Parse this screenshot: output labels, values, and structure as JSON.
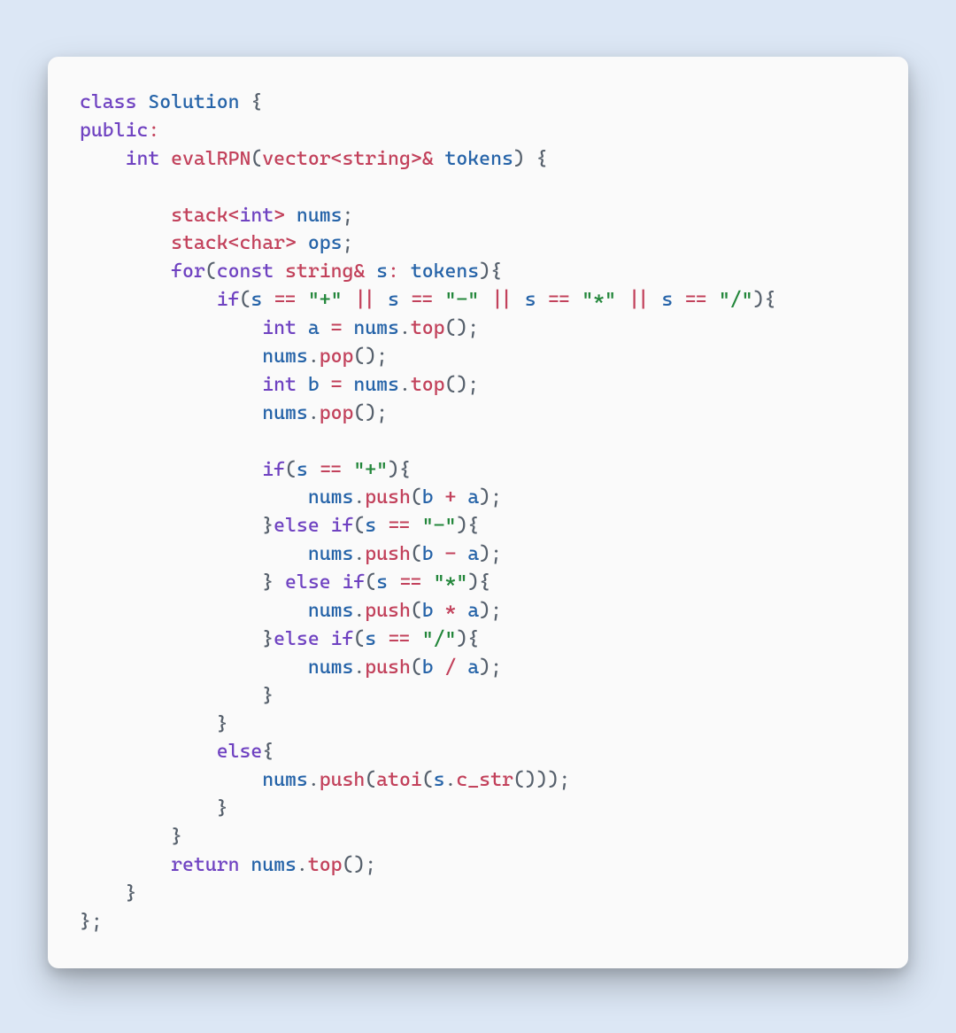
{
  "tokens": [
    [
      [
        "kw",
        "class"
      ],
      [
        "punc",
        " "
      ],
      [
        "name",
        "Solution"
      ],
      [
        "punc",
        " {"
      ]
    ],
    [
      [
        "kw",
        "public"
      ],
      [
        "op",
        ":"
      ]
    ],
    [
      [
        "punc",
        "    "
      ],
      [
        "kw",
        "int"
      ],
      [
        "punc",
        " "
      ],
      [
        "fn",
        "evalRPN"
      ],
      [
        "punc",
        "("
      ],
      [
        "type",
        "vector"
      ],
      [
        "op",
        "<"
      ],
      [
        "type",
        "string"
      ],
      [
        "op",
        ">&"
      ],
      [
        "punc",
        " "
      ],
      [
        "name",
        "tokens"
      ],
      [
        "punc",
        ") {"
      ]
    ],
    [
      [
        "punc",
        ""
      ]
    ],
    [
      [
        "punc",
        "        "
      ],
      [
        "type",
        "stack"
      ],
      [
        "op",
        "<"
      ],
      [
        "kw",
        "int"
      ],
      [
        "op",
        ">"
      ],
      [
        "punc",
        " "
      ],
      [
        "name",
        "nums"
      ],
      [
        "punc",
        ";"
      ]
    ],
    [
      [
        "punc",
        "        "
      ],
      [
        "type",
        "stack"
      ],
      [
        "op",
        "<"
      ],
      [
        "type",
        "char"
      ],
      [
        "op",
        ">"
      ],
      [
        "punc",
        " "
      ],
      [
        "name",
        "ops"
      ],
      [
        "punc",
        ";"
      ]
    ],
    [
      [
        "punc",
        "        "
      ],
      [
        "kw",
        "for"
      ],
      [
        "punc",
        "("
      ],
      [
        "kw",
        "const"
      ],
      [
        "punc",
        " "
      ],
      [
        "type",
        "string"
      ],
      [
        "op",
        "&"
      ],
      [
        "punc",
        " "
      ],
      [
        "name",
        "s"
      ],
      [
        "op",
        ":"
      ],
      [
        "punc",
        " "
      ],
      [
        "name",
        "tokens"
      ],
      [
        "punc",
        "){"
      ]
    ],
    [
      [
        "punc",
        "            "
      ],
      [
        "kw",
        "if"
      ],
      [
        "punc",
        "("
      ],
      [
        "name",
        "s"
      ],
      [
        "punc",
        " "
      ],
      [
        "op",
        "=="
      ],
      [
        "punc",
        " "
      ],
      [
        "str",
        "\"+\""
      ],
      [
        "punc",
        " "
      ],
      [
        "op",
        "||"
      ],
      [
        "punc",
        " "
      ],
      [
        "name",
        "s"
      ],
      [
        "punc",
        " "
      ],
      [
        "op",
        "=="
      ],
      [
        "punc",
        " "
      ],
      [
        "str",
        "\"-\""
      ],
      [
        "punc",
        " "
      ],
      [
        "op",
        "||"
      ],
      [
        "punc",
        " "
      ],
      [
        "name",
        "s"
      ],
      [
        "punc",
        " "
      ],
      [
        "op",
        "=="
      ],
      [
        "punc",
        " "
      ],
      [
        "str",
        "\"*\""
      ],
      [
        "punc",
        " "
      ],
      [
        "op",
        "||"
      ],
      [
        "punc",
        " "
      ],
      [
        "name",
        "s"
      ],
      [
        "punc",
        " "
      ],
      [
        "op",
        "=="
      ],
      [
        "punc",
        " "
      ],
      [
        "str",
        "\"/\""
      ],
      [
        "punc",
        "){"
      ]
    ],
    [
      [
        "punc",
        "                "
      ],
      [
        "kw",
        "int"
      ],
      [
        "punc",
        " "
      ],
      [
        "name",
        "a"
      ],
      [
        "punc",
        " "
      ],
      [
        "op",
        "="
      ],
      [
        "punc",
        " "
      ],
      [
        "name",
        "nums"
      ],
      [
        "punc",
        "."
      ],
      [
        "fn",
        "top"
      ],
      [
        "punc",
        "();"
      ]
    ],
    [
      [
        "punc",
        "                "
      ],
      [
        "name",
        "nums"
      ],
      [
        "punc",
        "."
      ],
      [
        "fn",
        "pop"
      ],
      [
        "punc",
        "();"
      ]
    ],
    [
      [
        "punc",
        "                "
      ],
      [
        "kw",
        "int"
      ],
      [
        "punc",
        " "
      ],
      [
        "name",
        "b"
      ],
      [
        "punc",
        " "
      ],
      [
        "op",
        "="
      ],
      [
        "punc",
        " "
      ],
      [
        "name",
        "nums"
      ],
      [
        "punc",
        "."
      ],
      [
        "fn",
        "top"
      ],
      [
        "punc",
        "();"
      ]
    ],
    [
      [
        "punc",
        "                "
      ],
      [
        "name",
        "nums"
      ],
      [
        "punc",
        "."
      ],
      [
        "fn",
        "pop"
      ],
      [
        "punc",
        "();"
      ]
    ],
    [
      [
        "punc",
        ""
      ]
    ],
    [
      [
        "punc",
        "                "
      ],
      [
        "kw",
        "if"
      ],
      [
        "punc",
        "("
      ],
      [
        "name",
        "s"
      ],
      [
        "punc",
        " "
      ],
      [
        "op",
        "=="
      ],
      [
        "punc",
        " "
      ],
      [
        "str",
        "\"+\""
      ],
      [
        "punc",
        "){"
      ]
    ],
    [
      [
        "punc",
        "                    "
      ],
      [
        "name",
        "nums"
      ],
      [
        "punc",
        "."
      ],
      [
        "fn",
        "push"
      ],
      [
        "punc",
        "("
      ],
      [
        "name",
        "b"
      ],
      [
        "punc",
        " "
      ],
      [
        "op",
        "+"
      ],
      [
        "punc",
        " "
      ],
      [
        "name",
        "a"
      ],
      [
        "punc",
        ");"
      ]
    ],
    [
      [
        "punc",
        "                }"
      ],
      [
        "kw",
        "else"
      ],
      [
        "punc",
        " "
      ],
      [
        "kw",
        "if"
      ],
      [
        "punc",
        "("
      ],
      [
        "name",
        "s"
      ],
      [
        "punc",
        " "
      ],
      [
        "op",
        "=="
      ],
      [
        "punc",
        " "
      ],
      [
        "str",
        "\"-\""
      ],
      [
        "punc",
        "){"
      ]
    ],
    [
      [
        "punc",
        "                    "
      ],
      [
        "name",
        "nums"
      ],
      [
        "punc",
        "."
      ],
      [
        "fn",
        "push"
      ],
      [
        "punc",
        "("
      ],
      [
        "name",
        "b"
      ],
      [
        "punc",
        " "
      ],
      [
        "op",
        "-"
      ],
      [
        "punc",
        " "
      ],
      [
        "name",
        "a"
      ],
      [
        "punc",
        ");"
      ]
    ],
    [
      [
        "punc",
        "                } "
      ],
      [
        "kw",
        "else"
      ],
      [
        "punc",
        " "
      ],
      [
        "kw",
        "if"
      ],
      [
        "punc",
        "("
      ],
      [
        "name",
        "s"
      ],
      [
        "punc",
        " "
      ],
      [
        "op",
        "=="
      ],
      [
        "punc",
        " "
      ],
      [
        "str",
        "\"*\""
      ],
      [
        "punc",
        "){"
      ]
    ],
    [
      [
        "punc",
        "                    "
      ],
      [
        "name",
        "nums"
      ],
      [
        "punc",
        "."
      ],
      [
        "fn",
        "push"
      ],
      [
        "punc",
        "("
      ],
      [
        "name",
        "b"
      ],
      [
        "punc",
        " "
      ],
      [
        "op",
        "*"
      ],
      [
        "punc",
        " "
      ],
      [
        "name",
        "a"
      ],
      [
        "punc",
        ");"
      ]
    ],
    [
      [
        "punc",
        "                }"
      ],
      [
        "kw",
        "else"
      ],
      [
        "punc",
        " "
      ],
      [
        "kw",
        "if"
      ],
      [
        "punc",
        "("
      ],
      [
        "name",
        "s"
      ],
      [
        "punc",
        " "
      ],
      [
        "op",
        "=="
      ],
      [
        "punc",
        " "
      ],
      [
        "str",
        "\"/\""
      ],
      [
        "punc",
        "){"
      ]
    ],
    [
      [
        "punc",
        "                    "
      ],
      [
        "name",
        "nums"
      ],
      [
        "punc",
        "."
      ],
      [
        "fn",
        "push"
      ],
      [
        "punc",
        "("
      ],
      [
        "name",
        "b"
      ],
      [
        "punc",
        " "
      ],
      [
        "op",
        "/"
      ],
      [
        "punc",
        " "
      ],
      [
        "name",
        "a"
      ],
      [
        "punc",
        ");"
      ]
    ],
    [
      [
        "punc",
        "                }"
      ]
    ],
    [
      [
        "punc",
        "            }"
      ]
    ],
    [
      [
        "punc",
        "            "
      ],
      [
        "kw",
        "else"
      ],
      [
        "punc",
        "{"
      ]
    ],
    [
      [
        "punc",
        "                "
      ],
      [
        "name",
        "nums"
      ],
      [
        "punc",
        "."
      ],
      [
        "fn",
        "push"
      ],
      [
        "punc",
        "("
      ],
      [
        "fn",
        "atoi"
      ],
      [
        "punc",
        "("
      ],
      [
        "name",
        "s"
      ],
      [
        "punc",
        "."
      ],
      [
        "fn",
        "c_str"
      ],
      [
        "punc",
        "()));"
      ]
    ],
    [
      [
        "punc",
        "            }"
      ]
    ],
    [
      [
        "punc",
        "        }"
      ]
    ],
    [
      [
        "punc",
        "        "
      ],
      [
        "kw",
        "return"
      ],
      [
        "punc",
        " "
      ],
      [
        "name",
        "nums"
      ],
      [
        "punc",
        "."
      ],
      [
        "fn",
        "top"
      ],
      [
        "punc",
        "();"
      ]
    ],
    [
      [
        "punc",
        "    }"
      ]
    ],
    [
      [
        "punc",
        "};"
      ]
    ]
  ]
}
